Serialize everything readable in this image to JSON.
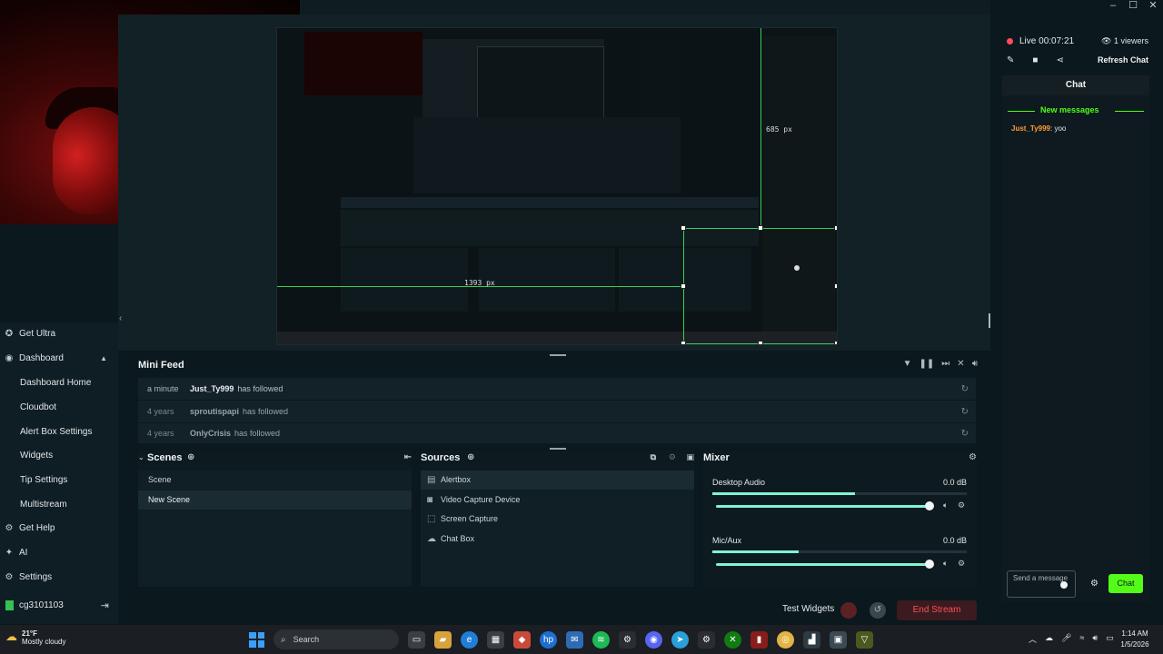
{
  "window": {
    "controls": [
      "–",
      "☐",
      "✕"
    ]
  },
  "nav": {
    "items": [
      {
        "label": "Get Ultra",
        "icon": "ultra-icon"
      },
      {
        "label": "Dashboard",
        "icon": "dashboard-icon"
      },
      {
        "label": "Dashboard Home"
      },
      {
        "label": "Cloudbot"
      },
      {
        "label": "Alert Box Settings"
      },
      {
        "label": "Widgets"
      },
      {
        "label": "Tip Settings"
      },
      {
        "label": "Multistream"
      },
      {
        "label": "Get Help",
        "icon": "help-icon"
      },
      {
        "label": "AI",
        "icon": "ai-icon"
      },
      {
        "label": "Settings",
        "icon": "gear-icon"
      }
    ],
    "user": "cg3101103"
  },
  "preview": {
    "label_height": "685 px",
    "label_width": "1393 px"
  },
  "minifeed": {
    "title": "Mini Feed",
    "rows": [
      {
        "time": "a minute",
        "user": "Just_Ty999",
        "action": "has followed"
      },
      {
        "time": "4 years",
        "user": "sproutispapi",
        "action": "has followed"
      },
      {
        "time": "4 years",
        "user": "OnlyCrisis",
        "action": "has followed"
      }
    ]
  },
  "scenes": {
    "title": "Scenes",
    "items": [
      "Scene",
      "New Scene"
    ]
  },
  "sources": {
    "title": "Sources",
    "items": [
      "Alertbox",
      "Video Capture Device",
      "Screen Capture",
      "Chat Box"
    ]
  },
  "mixer": {
    "title": "Mixer",
    "channels": [
      {
        "name": "Desktop Audio",
        "db": "0.0 dB",
        "level": 0.56
      },
      {
        "name": "Mic/Aux",
        "db": "0.0 dB",
        "level": 0.34
      }
    ]
  },
  "bottombar": {
    "test_widgets": "Test Widgets",
    "end_stream": "End Stream"
  },
  "chat": {
    "live_label": "Live",
    "live_time": "00:07:21",
    "viewers": "1 viewers",
    "refresh": "Refresh Chat",
    "title": "Chat",
    "new_messages": "New messages",
    "message_author": "Just_Ty999",
    "message_text": ": yoo",
    "input_placeholder": "Send a message",
    "send_button": "Chat"
  },
  "taskbar": {
    "temp": "21°F",
    "weather": "Mostly cloudy",
    "search": "Search",
    "time": "1:14 AM",
    "date": "1/5/2026"
  },
  "colors": {
    "accent_green": "#53fc18",
    "live_red": "#ff4e59",
    "end_stream_red": "#ff4e59",
    "meter": "#80f5d2",
    "chat_author": "#ff9c3b"
  }
}
